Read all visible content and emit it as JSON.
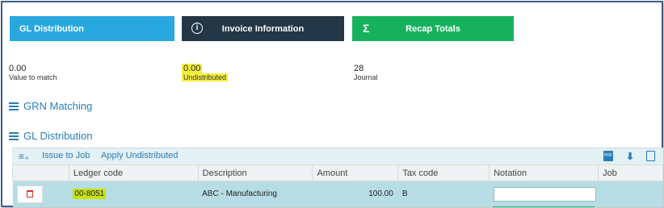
{
  "tabs": {
    "gl_distribution": "GL Distribution",
    "invoice_information": "Invoice Information",
    "recap_totals": "Recap Totals"
  },
  "stats": [
    {
      "value": "0.00",
      "label": "Value to match"
    },
    {
      "value": "0.00",
      "label": "Undistributed"
    },
    {
      "value": "28",
      "label": "Journal"
    }
  ],
  "sections": {
    "grn_matching": "GRN Matching",
    "gl_distribution": "GL Distribution"
  },
  "toolbar": {
    "issue_to_job": "Issue to Job",
    "apply_undistributed": "Apply Undistributed"
  },
  "table": {
    "columns": [
      "Ledger code",
      "Description",
      "Amount",
      "Tax code",
      "Notation",
      "Job"
    ],
    "rows": [
      {
        "ledger_code": "00-8051",
        "description": "ABC - Manufacturing",
        "amount": "100.00",
        "tax_code": "B",
        "notation": "",
        "job": ""
      }
    ]
  },
  "colors": {
    "gl_tab": "#29a8e0",
    "invoice_tab": "#243746",
    "recap_tab": "#17b15e",
    "link": "#2a7db8",
    "highlight": "#f4ef3b",
    "row_bg": "#b6dde4"
  },
  "icons": [
    "info-icon",
    "sigma-icon",
    "list-icon",
    "add-row-icon",
    "pdf-icon",
    "download-icon",
    "clipboard-icon",
    "trash-icon"
  ]
}
